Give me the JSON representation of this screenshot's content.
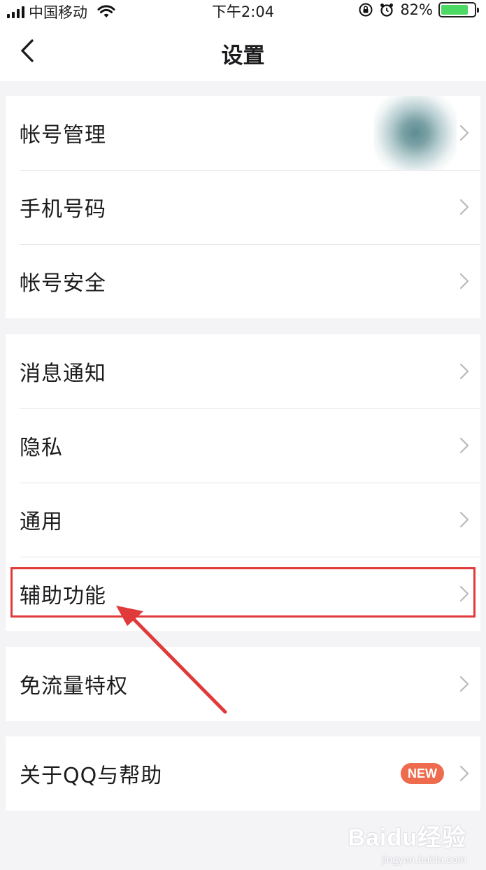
{
  "status_bar": {
    "carrier": "中国移动",
    "time": "下午2:04",
    "battery_percent": "82%",
    "battery_level": 0.82
  },
  "header": {
    "title": "设置"
  },
  "groups": [
    {
      "items": [
        {
          "label": "帐号管理"
        },
        {
          "label": "手机号码"
        },
        {
          "label": "帐号安全"
        }
      ]
    },
    {
      "items": [
        {
          "label": "消息通知"
        },
        {
          "label": "隐私"
        },
        {
          "label": "通用"
        },
        {
          "label": "辅助功能"
        }
      ]
    },
    {
      "items": [
        {
          "label": "免流量特权"
        }
      ]
    },
    {
      "items": [
        {
          "label": "关于QQ与帮助",
          "badge": "NEW"
        }
      ]
    }
  ],
  "watermark": {
    "brand": "Baidu经验",
    "url": "jingyan.baidu.com"
  },
  "colors": {
    "highlight": "#e03a3a",
    "badge": "#ee6b4d",
    "battery": "#4cd964"
  }
}
